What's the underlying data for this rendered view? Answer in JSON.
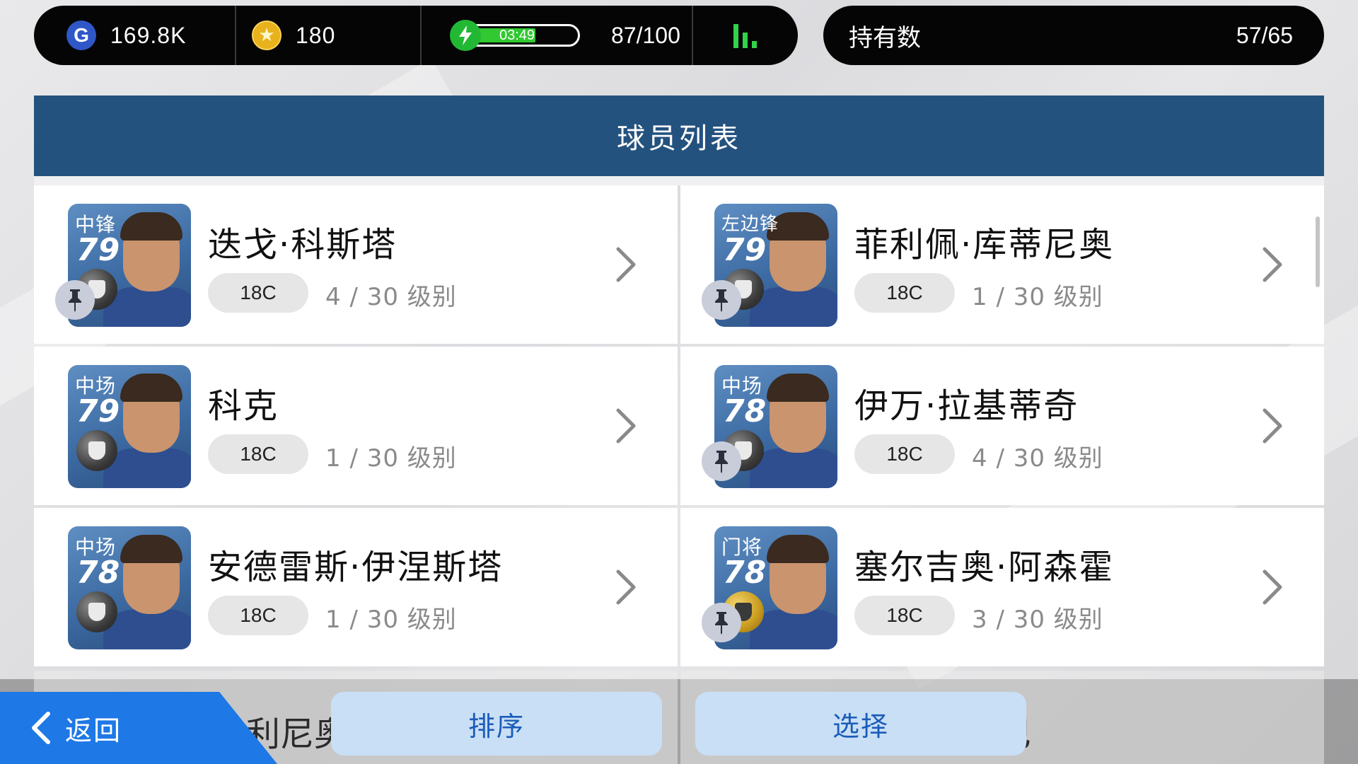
{
  "resources": {
    "gp": {
      "icon": "gp-coin-icon",
      "letter": "G",
      "value": "169.8K"
    },
    "coins": {
      "icon": "star-coin-icon",
      "value": "180"
    },
    "energy": {
      "icon": "lightning-bolt-icon",
      "timer": "03:49",
      "count": "87/100",
      "fill_fraction": 0.65
    },
    "stats": {
      "icon": "bar-chart-icon"
    }
  },
  "ownership": {
    "label": "持有数",
    "count": "57/65"
  },
  "header": {
    "title": "球员列表"
  },
  "players": [
    {
      "position": "中锋",
      "rating": "79",
      "name": "迭戈·科斯塔",
      "type": "18C",
      "level": "4 / 30 级别",
      "badge": "silver",
      "pinned": true
    },
    {
      "position": "左边锋",
      "rating": "79",
      "name": "菲利佩·库蒂尼奥",
      "type": "18C",
      "level": "1 / 30 级别",
      "badge": "silver",
      "pinned": true
    },
    {
      "position": "中场",
      "rating": "79",
      "name": "科克",
      "type": "18C",
      "level": "1 / 30 级别",
      "badge": "silver",
      "pinned": false
    },
    {
      "position": "中场",
      "rating": "78",
      "name": "伊万·拉基蒂奇",
      "type": "18C",
      "level": "4 / 30 级别",
      "badge": "silver",
      "pinned": true
    },
    {
      "position": "中场",
      "rating": "78",
      "name": "安德雷斯·伊涅斯塔",
      "type": "18C",
      "level": "1 / 30 级别",
      "badge": "silver",
      "pinned": false
    },
    {
      "position": "门将",
      "rating": "78",
      "name": "塞尔吉奥·阿森霍",
      "type": "18C",
      "level": "3 / 30 级别",
      "badge": "gold",
      "pinned": true
    }
  ],
  "peek": {
    "left_name": "利尼奥",
    "right_name": "尔巴"
  },
  "footer": {
    "back_label": "返回",
    "sort_label": "排序",
    "select_label": "选择"
  },
  "colors": {
    "header": "#24527f",
    "back_button": "#1e78e6",
    "action_button": "#c9dff6",
    "energy": "#31c831"
  }
}
